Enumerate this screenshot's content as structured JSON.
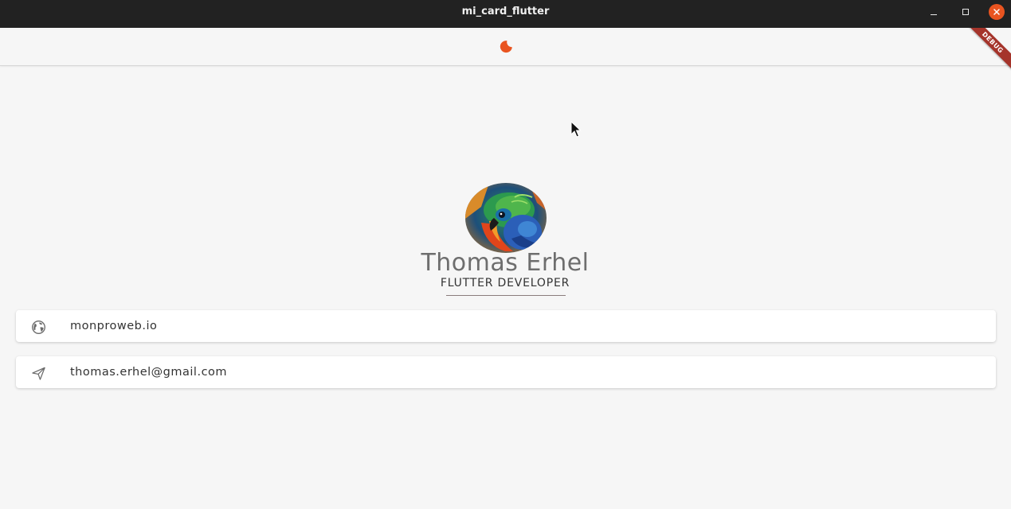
{
  "window": {
    "title": "mi_card_flutter",
    "controls": {
      "minimize_icon": "minimize-icon",
      "maximize_icon": "maximize-icon",
      "close_icon": "close-icon"
    }
  },
  "appbar": {
    "theme_toggle_icon": "moon-icon",
    "accent_color": "#e95420"
  },
  "debug_banner": "DEBUG",
  "profile": {
    "avatar": "parrot-avatar",
    "name": "Thomas Erhel",
    "role": "FLUTTER DEVELOPER"
  },
  "contacts": [
    {
      "icon": "globe-icon",
      "label": "monproweb.io"
    },
    {
      "icon": "send-icon",
      "label": "thomas.erhel@gmail.com"
    }
  ]
}
